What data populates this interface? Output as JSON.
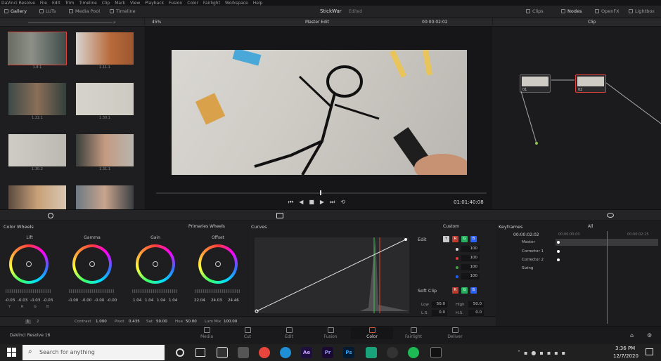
{
  "menu": [
    "DaVinci Resolve",
    "File",
    "Edit",
    "Trim",
    "Timeline",
    "Clip",
    "Mark",
    "View",
    "Playback",
    "Fusion",
    "Color",
    "Fairlight",
    "Workspace",
    "Help"
  ],
  "topbar": {
    "gallery": "Gallery",
    "luts": "LUTs",
    "media_pool": "Media Pool",
    "timeline": "Timeline",
    "project_title": "StickWar",
    "project_status": "Edited",
    "clips": "Clips",
    "nodes": "Nodes",
    "openfx": "OpenFX",
    "lightbox": "Lightbox"
  },
  "viewer": {
    "zoom": "45%",
    "timeline_name": "Master Edit",
    "timecode_top": "00:00:02:02",
    "timecode": "01:01:40:08"
  },
  "node_editor": {
    "mode": "Clip",
    "nodes": [
      {
        "label": "01"
      },
      {
        "label": "02"
      }
    ]
  },
  "gallery_thumbs": [
    {
      "label": "1.8.1"
    },
    {
      "label": "1.11.1"
    },
    {
      "label": "1.22.1"
    },
    {
      "label": "1.30.1"
    },
    {
      "label": "1.30.2"
    },
    {
      "label": "1.31.1"
    },
    {
      "label": ""
    },
    {
      "label": ""
    }
  ],
  "color_wheels": {
    "title": "Color Wheels",
    "mode": "Primaries Wheels",
    "wheels": [
      {
        "name": "Lift",
        "values": [
          "-0.03",
          "-0.03",
          "-0.03",
          "-0.03"
        ]
      },
      {
        "name": "Gamma",
        "values": [
          "-0.00",
          "-0.00",
          "-0.00",
          "-0.00"
        ]
      },
      {
        "name": "Gain",
        "values": [
          "1.04",
          "1.04",
          "1.04",
          "1.04"
        ]
      },
      {
        "name": "Offset",
        "values": [
          "22.04",
          "24.03",
          "24.46",
          ""
        ]
      }
    ],
    "channels": [
      "Y",
      "R",
      "G",
      "B"
    ]
  },
  "bottom_params": {
    "page1": "1",
    "page2": "2",
    "contrast_label": "Contrast",
    "contrast": "1.000",
    "pivot_label": "Pivot",
    "pivot": "0.435",
    "sat_label": "Sat",
    "sat": "50.00",
    "hue_label": "Hue",
    "hue": "50.00",
    "lummix_label": "Lum Mix",
    "lummix": "100.00"
  },
  "curves": {
    "title": "Curves",
    "mode": "Custom"
  },
  "edit_panel": {
    "title": "Edit",
    "values": [
      "100",
      "100",
      "100",
      "100"
    ],
    "soft_clip": "Soft Clip",
    "low_label": "Low",
    "low": "50.0",
    "high_label": "High",
    "high": "50.0",
    "ls_label": "L.S.",
    "ls": "0.0",
    "hs_label": "H.S.",
    "hs": "0.0"
  },
  "keyframes": {
    "title": "Keyframes",
    "filter": "All",
    "timecode": "00:00:02:02",
    "ruler_start": "00:00:00:00",
    "ruler_end": "00:00:02:25",
    "rows": [
      "Master",
      "Corrector 1",
      "Corrector 2",
      "Sizing"
    ]
  },
  "pages": [
    "Media",
    "Cut",
    "Edit",
    "Fusion",
    "Color",
    "Fairlight",
    "Deliver"
  ],
  "active_page": "Color",
  "resolve_label": "DaVinci Resolve 16",
  "taskbar": {
    "search_placeholder": "Search for anything",
    "time": "3:36 PM",
    "date": "12/7/2020",
    "apps": [
      "Ae",
      "Pr",
      "Ps"
    ]
  }
}
